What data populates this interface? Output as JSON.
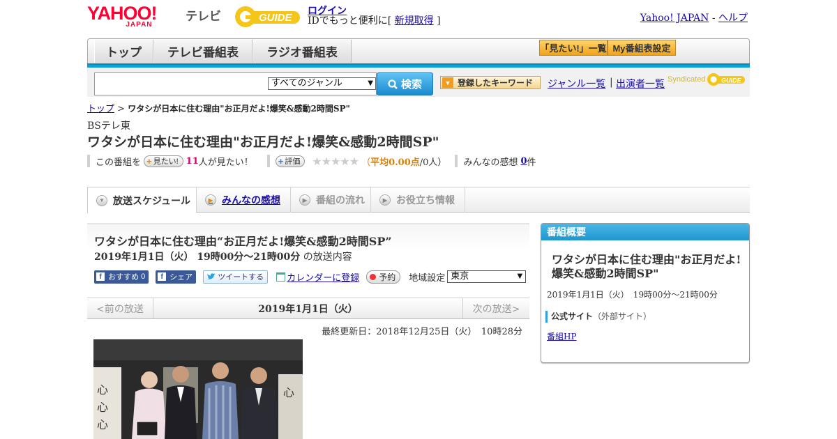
{
  "header": {
    "yahoo_logo": "YAHOO!",
    "yahoo_logo_sub": "JAPAN",
    "tv_label": "テレビ",
    "gguide_logo": "GUIDE",
    "login_label": "ログイン",
    "login_sub_prefix": "IDでもっと便利に[",
    "signup_label": "新規取得",
    "login_sub_suffix": "]",
    "yahoo_japan_link": "Yahoo! JAPAN",
    "separator": "-",
    "help_link": "ヘルプ"
  },
  "nav": {
    "tabs": [
      {
        "label": "トップ"
      },
      {
        "label": "テレビ番組表"
      },
      {
        "label": "ラジオ番組表"
      }
    ],
    "mitai_list": "「見たい!」一覧",
    "my_settings": "My番組表設定"
  },
  "search": {
    "genre_selected": "すべてのジャンル",
    "button_label": "検索",
    "keyword_button": "登録したキーワード",
    "genre_list": "ジャンル一覧",
    "divider": "|",
    "performer_list": "出演者一覧",
    "syndicated": "Syndicated",
    "syndicated_logo": "GUIDE"
  },
  "breadcrumb": {
    "top": "トップ",
    "sep": ">",
    "current": "ワタシが日本に住む理由\"お正月だよ!爆笑&感動2時間SP\""
  },
  "program": {
    "channel": "BSテレ東",
    "title": "ワタシが日本に住む理由\"お正月だよ!爆笑&感動2時間SP\"",
    "mitai_prefix": "この番組を",
    "mitai_button": "見たい!",
    "mitai_count": "11",
    "mitai_suffix": "人が見たい！",
    "rate_button": "評価",
    "stars": "★★★★★",
    "avg_open": "（",
    "avg_label": "平均0.00点",
    "avg_people": "/0人）",
    "impressions_label": "みんなの感想",
    "impressions_count": "0",
    "impressions_unit": "件",
    "rating": 0
  },
  "subtabs": [
    {
      "label": "放送スケジュール"
    },
    {
      "label": "みんなの感想"
    },
    {
      "label": "番組の流れ"
    },
    {
      "label": "お役立ち情報"
    }
  ],
  "episode": {
    "title": "ワタシが日本に住む理由“お正月だよ!爆笑&感動2時間SP”",
    "datetime": "2019年1月1日（火） 19時00分～21時00分",
    "datetime_suffix": "の放送内容",
    "recommend": "おすすめ",
    "recommend_count": "0",
    "share": "シェア",
    "tweet": "ツイートする",
    "calendar": "カレンダーに登録",
    "reserve": "予約",
    "region_label": "地域設定",
    "region_value": "東京",
    "prev": "<前の放送",
    "date": "2019年1月1日（火）",
    "next": "次の放送>",
    "last_updated": "最終更新日：2018年12月25日（火）　10時28分"
  },
  "summary_panel": {
    "heading": "番組概要",
    "title": "ワタシが日本に住む理由\"お正月だよ!爆笑&感動2時間SP\"",
    "time": "2019年1月1日（火）　19時00分～21時00分",
    "official_label": "公式サイト",
    "official_note": "（外部サイト）",
    "hp_link": "番組HP"
  },
  "colors": {
    "accent_blue": "#0aa3d9",
    "yahoo_red": "#ff0033",
    "link": "#1a0dab",
    "mitai_pink": "#d6006d"
  },
  "icons": {
    "search": "search-icon",
    "dropdown": "chevron-down-icon",
    "facebook": "facebook-icon",
    "twitter": "twitter-icon",
    "calendar": "calendar-icon",
    "record": "record-icon"
  }
}
